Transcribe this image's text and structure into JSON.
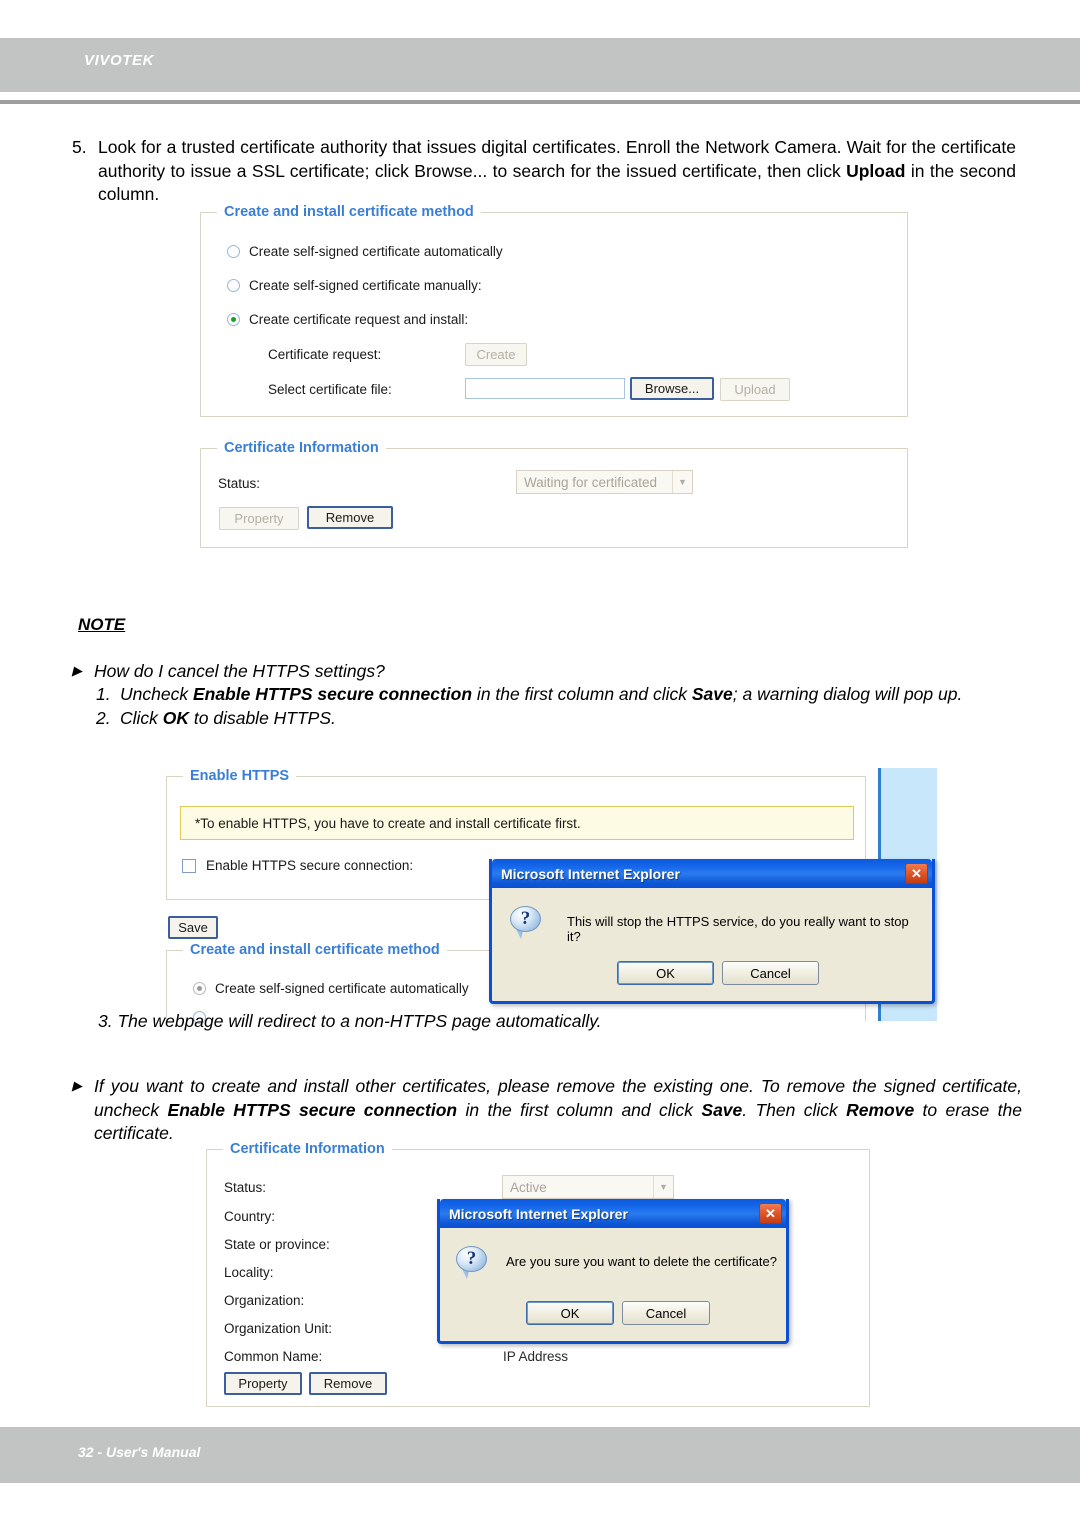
{
  "page": {
    "brand": "VIVOTEK",
    "footer": "32 - User's Manual"
  },
  "instruction_5": {
    "number": "5.",
    "part1": "Look for a trusted certificate authority that issues digital certificates. Enroll the Network Camera. Wait for the certificate authority to issue a SSL certificate; click Browse... to search for the issued certificate, then click ",
    "bold": "Upload",
    "part2": " in the second column."
  },
  "note": {
    "heading": "NOTE",
    "question": "How do I cancel the HTTPS settings?",
    "steps": [
      {
        "number": "1.",
        "part1": "Uncheck ",
        "bold1": "Enable HTTPS secure connection",
        "part2": " in the first column and click ",
        "bold2": "Save",
        "part3": "; a warning dialog will pop up."
      },
      {
        "number": "2.",
        "part1": "Click ",
        "bold1": "OK",
        "part2": " to disable HTTPS.",
        "bold2": "",
        "part3": ""
      }
    ],
    "step3": "3. The webpage will redirect to a non-HTTPS page automatically."
  },
  "remove_para": {
    "part1": "If you want to create and install other certificates, please remove the existing one. To remove the signed certificate, uncheck ",
    "bold1": "Enable HTTPS secure connection",
    "part2": " in the first column and click ",
    "bold2": "Save",
    "part3": ". Then click ",
    "bold3": "Remove",
    "part4": " to erase the certificate."
  },
  "shot1": {
    "panel_method_legend": "Create and install certificate method",
    "radio_auto": "Create self-signed certificate automatically",
    "radio_manual": "Create self-signed certificate manually:",
    "radio_request": "Create certificate request and install:",
    "label_cert_request": "Certificate request:",
    "btn_create": "Create",
    "label_select_file": "Select certificate file:",
    "file_value": "",
    "btn_browse": "Browse...",
    "btn_upload": "Upload",
    "panel_info_legend": "Certificate Information",
    "label_status": "Status:",
    "status_value": "Waiting for certificated",
    "btn_property": "Property",
    "btn_remove": "Remove"
  },
  "shot2": {
    "panel_https_legend": "Enable HTTPS",
    "warning_note": "*To enable HTTPS, you have to create and install certificate first.",
    "checkbox_label": "Enable HTTPS secure connection:",
    "btn_save": "Save",
    "panel_method_legend": "Create and install certificate method",
    "radio_auto": "Create self-signed certificate automatically"
  },
  "shot3": {
    "panel_info_legend": "Certificate Information",
    "fields": [
      "Status:",
      "Country:",
      "State or province:",
      "Locality:",
      "Organization:",
      "Organization Unit:",
      "Common Name:"
    ],
    "status_value": "Active",
    "common_name_value": "IP Address",
    "btn_property": "Property",
    "btn_remove": "Remove"
  },
  "dialog_stop": {
    "title": "Microsoft Internet Explorer",
    "message": "This will stop the HTTPS service, do you really want to stop it?",
    "btn_ok": "OK",
    "btn_cancel": "Cancel",
    "close_glyph": "✕"
  },
  "dialog_delete": {
    "title": "Microsoft Internet Explorer",
    "message": "Are you sure you want to delete the certificate?",
    "btn_ok": "OK",
    "btn_cancel": "Cancel",
    "close_glyph": "✕"
  },
  "colors": {
    "chrome_gray": "#c2c3c3",
    "panel_legend_blue": "#3a7fd5",
    "titlebar_blue": "#0a4fd4",
    "accent_yellow": "#fdfbe3",
    "radio_green": "#19a319"
  }
}
